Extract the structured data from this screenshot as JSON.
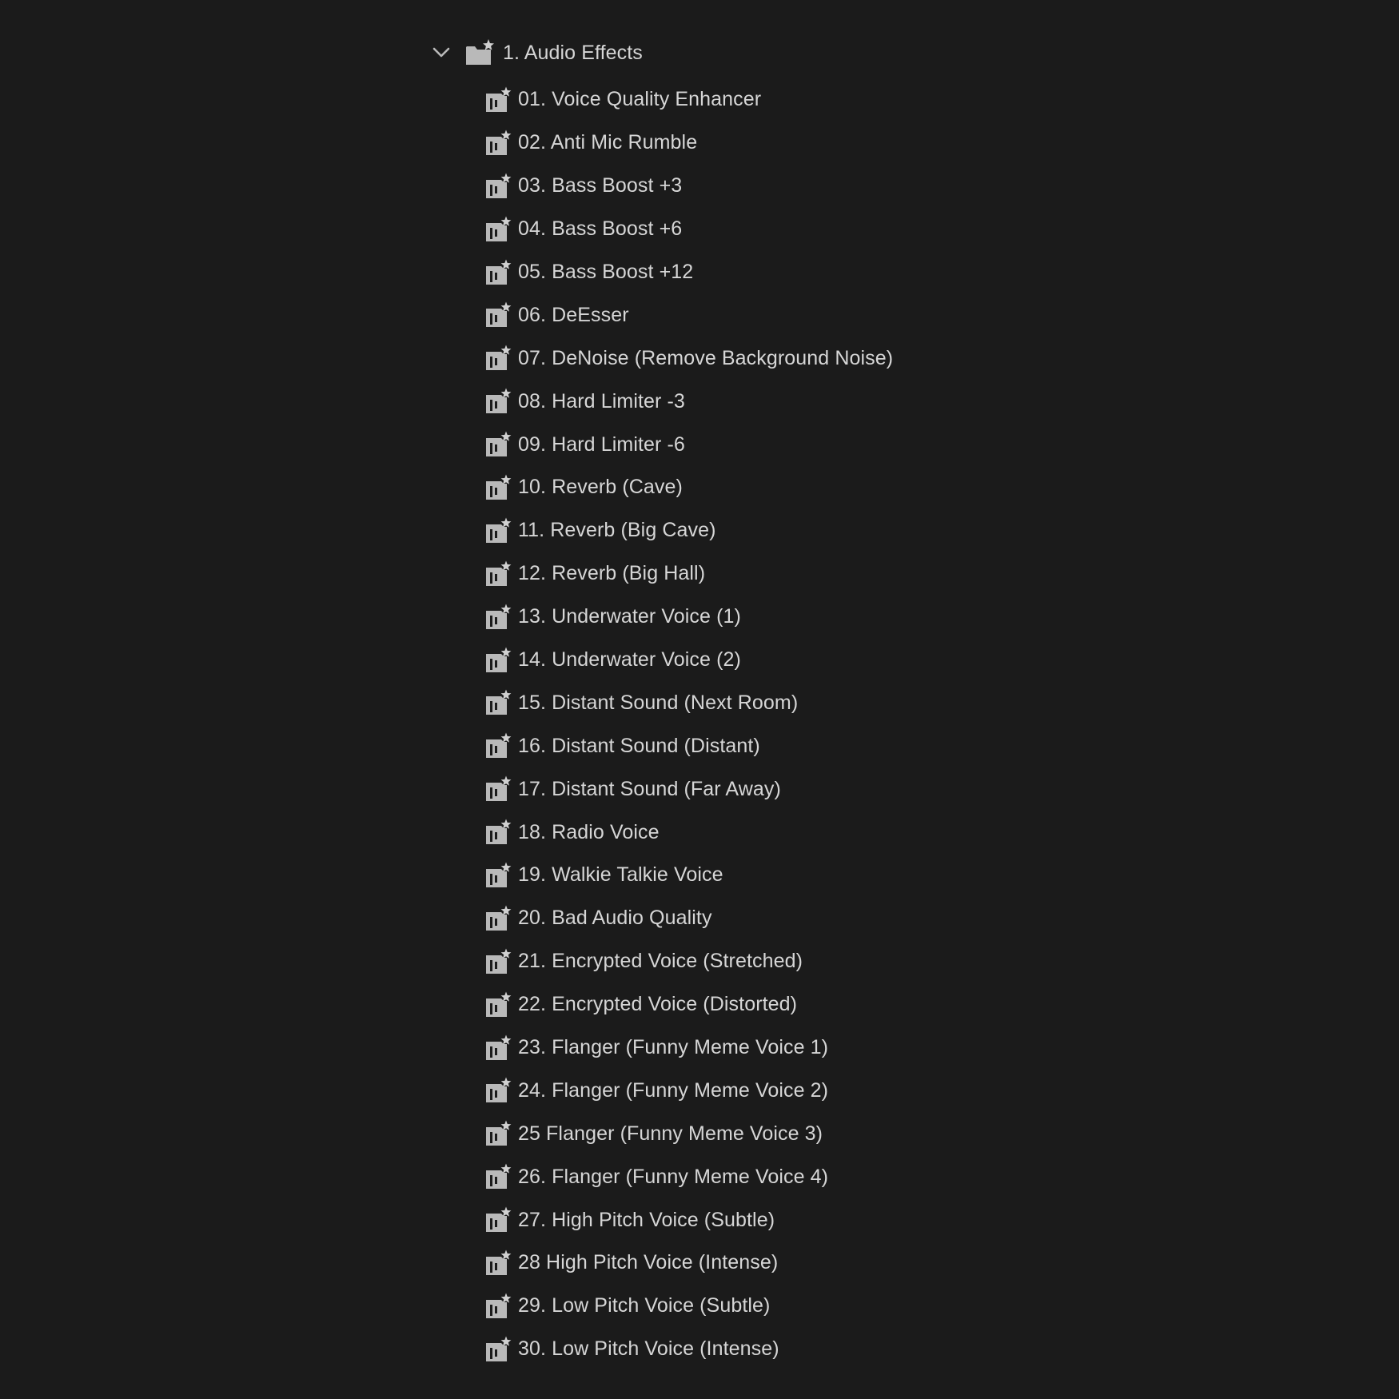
{
  "colors": {
    "background": "#1b1b1b",
    "text": "#d6d6d6",
    "icon": "#b9b9b9"
  },
  "folder": {
    "label": "1. Audio Effects",
    "expanded": true,
    "toggle_icon": "chevron-down-icon",
    "icon": "preset-bin-folder-icon"
  },
  "presets": [
    {
      "label": "01. Voice Quality Enhancer",
      "icon": "effect-preset-icon"
    },
    {
      "label": "02. Anti Mic Rumble",
      "icon": "effect-preset-icon"
    },
    {
      "label": "03. Bass Boost +3",
      "icon": "effect-preset-icon"
    },
    {
      "label": "04. Bass Boost +6",
      "icon": "effect-preset-icon"
    },
    {
      "label": "05. Bass Boost +12",
      "icon": "effect-preset-icon"
    },
    {
      "label": "06. DeEsser",
      "icon": "effect-preset-icon"
    },
    {
      "label": "07. DeNoise (Remove Background Noise)",
      "icon": "effect-preset-icon"
    },
    {
      "label": "08. Hard Limiter -3",
      "icon": "effect-preset-icon"
    },
    {
      "label": "09. Hard Limiter -6",
      "icon": "effect-preset-icon"
    },
    {
      "label": "10. Reverb (Cave)",
      "icon": "effect-preset-icon"
    },
    {
      "label": "11. Reverb (Big Cave)",
      "icon": "effect-preset-icon"
    },
    {
      "label": "12. Reverb (Big Hall)",
      "icon": "effect-preset-icon"
    },
    {
      "label": "13. Underwater Voice (1)",
      "icon": "effect-preset-icon"
    },
    {
      "label": "14. Underwater Voice (2)",
      "icon": "effect-preset-icon"
    },
    {
      "label": "15. Distant Sound (Next Room)",
      "icon": "effect-preset-icon"
    },
    {
      "label": "16. Distant Sound (Distant)",
      "icon": "effect-preset-icon"
    },
    {
      "label": "17. Distant Sound (Far Away)",
      "icon": "effect-preset-icon"
    },
    {
      "label": "18. Radio Voice",
      "icon": "effect-preset-icon"
    },
    {
      "label": "19. Walkie Talkie Voice",
      "icon": "effect-preset-icon"
    },
    {
      "label": "20. Bad Audio Quality",
      "icon": "effect-preset-icon"
    },
    {
      "label": "21. Encrypted Voice (Stretched)",
      "icon": "effect-preset-icon"
    },
    {
      "label": "22. Encrypted Voice (Distorted)",
      "icon": "effect-preset-icon"
    },
    {
      "label": "23. Flanger (Funny Meme Voice 1)",
      "icon": "effect-preset-icon"
    },
    {
      "label": "24. Flanger (Funny Meme Voice 2)",
      "icon": "effect-preset-icon"
    },
    {
      "label": "25 Flanger (Funny Meme Voice 3)",
      "icon": "effect-preset-icon"
    },
    {
      "label": "26. Flanger (Funny Meme Voice 4)",
      "icon": "effect-preset-icon"
    },
    {
      "label": "27. High Pitch Voice (Subtle)",
      "icon": "effect-preset-icon"
    },
    {
      "label": "28 High Pitch Voice (Intense)",
      "icon": "effect-preset-icon"
    },
    {
      "label": "29. Low Pitch Voice (Subtle)",
      "icon": "effect-preset-icon"
    },
    {
      "label": "30. Low Pitch Voice (Intense)",
      "icon": "effect-preset-icon"
    }
  ]
}
